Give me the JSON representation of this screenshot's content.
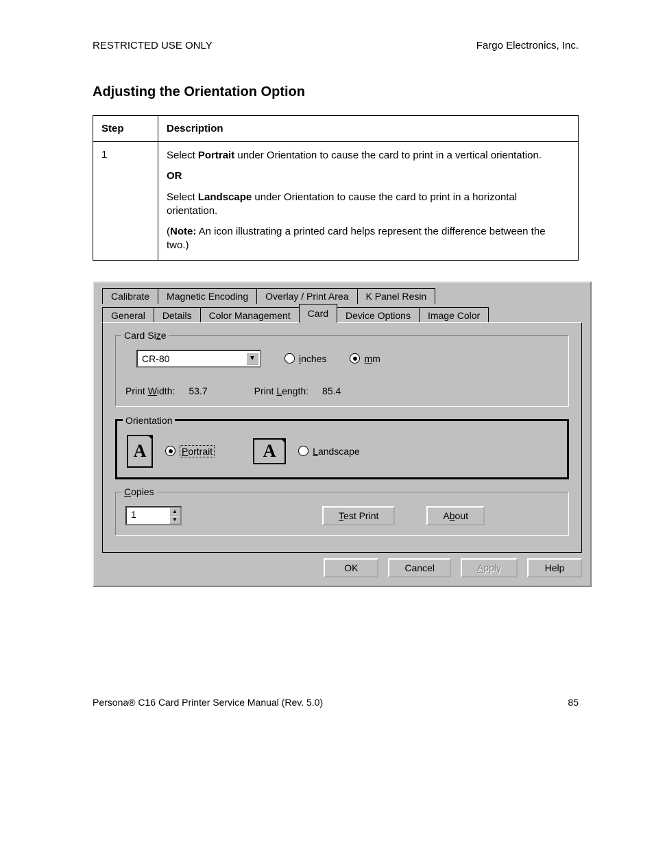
{
  "header": {
    "left": "RESTRICTED USE ONLY",
    "right": "Fargo Electronics, Inc."
  },
  "section_title": "Adjusting the Orientation Option",
  "table": {
    "headers": {
      "step": "Step",
      "description": "Description"
    },
    "row": {
      "step": "1",
      "p1_a": "Select ",
      "p1_b": "Portrait",
      "p1_c": " under Orientation to cause the card to print in a vertical orientation.",
      "or": "OR",
      "p2_a": "Select ",
      "p2_b": "Landscape",
      "p2_c": " under Orientation to cause the card to print in a horizontal orientation.",
      "note_a": "(",
      "note_b": "Note:",
      "note_c": "  An icon illustrating a printed card helps represent the difference between the two.)"
    }
  },
  "dialog": {
    "tabs_row1": [
      "Calibrate",
      "Magnetic Encoding",
      "Overlay / Print Area",
      "K Panel Resin"
    ],
    "tabs_row2": [
      "General",
      "Details",
      "Color Management",
      "Card",
      "Device Options",
      "Image Color"
    ],
    "active_tab": "Card",
    "card_size": {
      "legend_pre": "Card Si",
      "legend_u": "z",
      "legend_post": "e",
      "dropdown_value": "CR-80",
      "unit_inches_u": "i",
      "unit_inches_post": "nches",
      "unit_mm_u": "m",
      "unit_mm_post": "m",
      "print_width_label_pre": "Print ",
      "print_width_label_u": "W",
      "print_width_label_post": "idth:",
      "print_width_value": "53.7",
      "print_length_label_pre": "Print ",
      "print_length_label_u": "L",
      "print_length_label_post": "ength:",
      "print_length_value": "85.4"
    },
    "orientation": {
      "legend": "Orientation",
      "portrait_u": "P",
      "portrait_post": "ortrait",
      "landscape_u": "L",
      "landscape_post": "andscape",
      "glyph": "A"
    },
    "copies": {
      "legend_u": "C",
      "legend_post": "opies",
      "value": "1",
      "test_print_u": "T",
      "test_print_post": "est Print",
      "about_pre": "A",
      "about_u": "b",
      "about_post": "out"
    },
    "buttons": {
      "ok": "OK",
      "cancel": "Cancel",
      "apply_u": "A",
      "apply_post": "pply",
      "help": "Help"
    }
  },
  "footer": {
    "left_a": "Persona",
    "left_reg": "®",
    "left_b": " C16 Card Printer Service Manual (Rev. 5.0)",
    "page": "85"
  }
}
